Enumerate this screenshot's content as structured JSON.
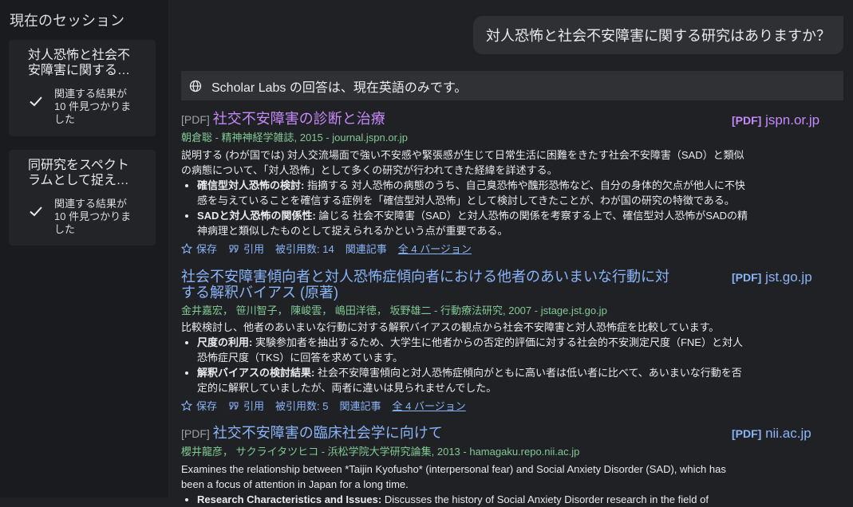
{
  "sidebar": {
    "title": "現在のセッション",
    "sessions": [
      {
        "title": "対人恐怖と社会不安障害に関する研究はありますか？",
        "status": "関連する結果が10 件見つかりました"
      },
      {
        "title": "同研究をスペクトラムとして捉える内容はありますか？",
        "status": "関連する結果が10 件見つかりました"
      }
    ]
  },
  "query": "対人恐怖と社会不安障害に関する研究はありますか？",
  "notice": "Scholar Labs の回答は、現在英語のみです。",
  "results": [
    {
      "pdf_tag": "[PDF]",
      "title": "社交不安障害の診断と治療",
      "side_tag": "[PDF]",
      "side_domain": "jspn.or.jp",
      "meta": "朝倉聡 - 精神神経学雑誌, 2015 - journal.jspn.or.jp",
      "snippet": "説明する (わが国では) 対人交流場面で強い不安感や緊張感が生じて日常生活に困難をきたす社会不安障害（SAD）と類似の病態について、「対人恐怖」として多くの研究が行われてきた経緯を詳述する。",
      "bullets": [
        {
          "label": "確信型対人恐怖の検討:",
          "text": "指摘する 対人恐怖の病態のうち、自己臭恐怖や醜形恐怖など、自分の身体的欠点が他人に不快感を与えていることを確信する症例を「確信型対人恐怖」として検討してきたことが、わが国の研究の特徴である。"
        },
        {
          "label": "SADと対人恐怖の関係性:",
          "text": "論じる 社会不安障害（SAD）と対人恐怖の関係を考察する上で、確信型対人恐怖がSADの精神病理と類似したものとして捉えられるかという点が重要である。"
        }
      ],
      "actions": {
        "save": "保存",
        "cite": "引用",
        "cited_by": "被引用数: 14",
        "related": "関連記事",
        "versions": "全 4 バージョン"
      }
    },
    {
      "pdf_tag": "",
      "title": "社会不安障害傾向者と対人恐怖症傾向者における他者のあいまいな行動に対する解釈バイアス (原著)",
      "side_tag": "[PDF]",
      "side_domain": "jst.go.jp",
      "meta": "金井嘉宏， 笹川智子， 陳峻雲， 嶋田洋徳， 坂野雄二 - 行動療法研究, 2007 - jstage.jst.go.jp",
      "snippet": "比較検討し、他者のあいまいな行動に対する解釈バイアスの観点から社会不安障害と対人恐怖症を比較しています。",
      "bullets": [
        {
          "label": "尺度の利用:",
          "text": "実験参加者を抽出するため、大学生に他者からの否定的評価に対する社会的不安測定尺度（FNE）と対人恐怖症尺度（TKS）に回答を求めています。"
        },
        {
          "label": "解釈バイアスの検討結果:",
          "text": "社会不安障害傾向と対人恐怖症傾向がともに高い者は低い者に比べて、あいまいな行動を否定的に解釈していましたが、両者に違いは見られませんでした。"
        }
      ],
      "actions": {
        "save": "保存",
        "cite": "引用",
        "cited_by": "被引用数: 5",
        "related": "関連記事",
        "versions": "全 4 バージョン"
      }
    },
    {
      "pdf_tag": "[PDF]",
      "title": "社交不安障害の臨床社会学に向けて",
      "side_tag": "[PDF]",
      "side_domain": "nii.ac.jp",
      "meta": "櫻井龍彦， サクライタツヒコ - 浜松学院大学研究論集, 2013 - hamagaku.repo.nii.ac.jp",
      "snippet": "Examines the relationship between *Taijin Kyofusho* (interpersonal fear) and Social Anxiety Disorder (SAD), which has been a focus of attention in Japan for a long time.",
      "bullets": [
        {
          "label": "Research Characteristics and Issues:",
          "text": "Discusses the history of Social Anxiety Disorder research in the field of"
        }
      ]
    }
  ]
}
